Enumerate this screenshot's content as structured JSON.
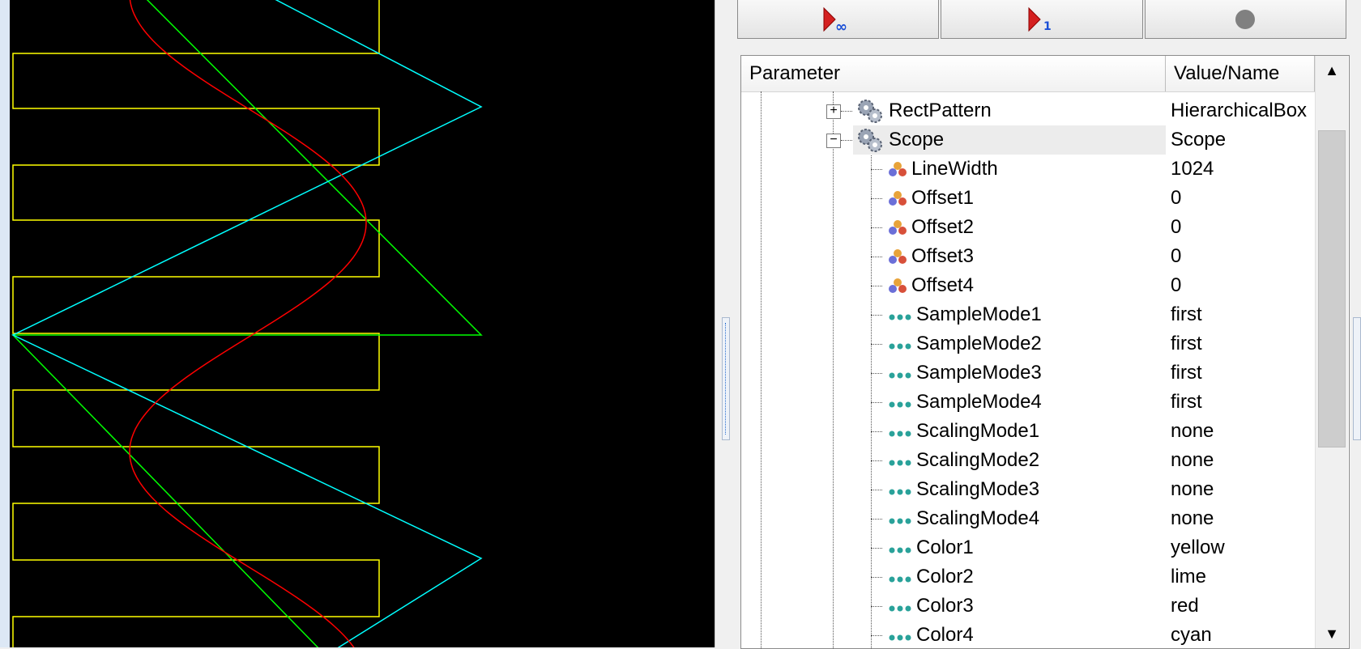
{
  "scope_panel": {
    "background": "#000000",
    "trace_colors": {
      "rect": "#ffff00",
      "diag": "#00ff00",
      "sine": "#ff0000",
      "tri": "#00ffff"
    }
  },
  "toolbar": {
    "buttons": [
      {
        "icon": "run-continuous-icon",
        "sub": "∞"
      },
      {
        "icon": "run-once-icon",
        "sub": "1"
      },
      {
        "icon": "stop-icon"
      }
    ]
  },
  "grid": {
    "header": {
      "param": "Parameter",
      "value": "Value/Name"
    },
    "rows": [
      {
        "label": "RectPattern",
        "value": "HierarchicalBox",
        "kind": "block",
        "expander": "+"
      },
      {
        "label": "Scope",
        "value": "Scope",
        "kind": "block",
        "expander": "−",
        "selected": true
      },
      {
        "label": "LineWidth",
        "value": "1024",
        "kind": "param"
      },
      {
        "label": "Offset1",
        "value": "0",
        "kind": "param"
      },
      {
        "label": "Offset2",
        "value": "0",
        "kind": "param"
      },
      {
        "label": "Offset3",
        "value": "0",
        "kind": "param"
      },
      {
        "label": "Offset4",
        "value": "0",
        "kind": "param"
      },
      {
        "label": "SampleMode1",
        "value": "first",
        "kind": "enum"
      },
      {
        "label": "SampleMode2",
        "value": "first",
        "kind": "enum"
      },
      {
        "label": "SampleMode3",
        "value": "first",
        "kind": "enum"
      },
      {
        "label": "SampleMode4",
        "value": "first",
        "kind": "enum"
      },
      {
        "label": "ScalingMode1",
        "value": "none",
        "kind": "enum"
      },
      {
        "label": "ScalingMode2",
        "value": "none",
        "kind": "enum"
      },
      {
        "label": "ScalingMode3",
        "value": "none",
        "kind": "enum"
      },
      {
        "label": "ScalingMode4",
        "value": "none",
        "kind": "enum"
      },
      {
        "label": "Color1",
        "value": "yellow",
        "kind": "enum"
      },
      {
        "label": "Color2",
        "value": "lime",
        "kind": "enum"
      },
      {
        "label": "Color3",
        "value": "red",
        "kind": "enum"
      },
      {
        "label": "Color4",
        "value": "cyan",
        "kind": "enum"
      }
    ]
  }
}
